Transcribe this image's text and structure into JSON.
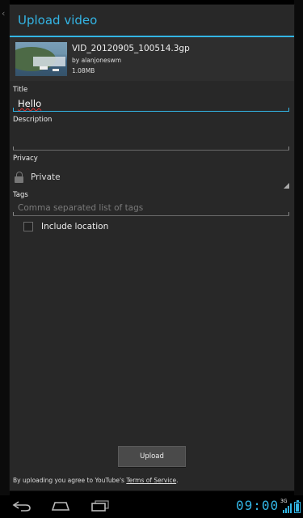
{
  "dialog": {
    "title": "Upload video"
  },
  "file": {
    "name": "VID_20120905_100514.3gp",
    "owner": "by alanjoneswm",
    "size": "1.08MB"
  },
  "form": {
    "title_label": "Title",
    "title_value": "Hello",
    "description_label": "Description",
    "description_value": "",
    "privacy_label": "Privacy",
    "privacy_value": "Private",
    "tags_label": "Tags",
    "tags_placeholder": "Comma separated list of tags",
    "include_location_label": "Include location",
    "include_location_checked": false
  },
  "actions": {
    "upload_label": "Upload"
  },
  "terms": {
    "prefix": "By uploading you agree to YouTube's ",
    "link": "Terms of Service",
    "suffix": "."
  },
  "status_bar": {
    "time": "09:00",
    "network": "3G",
    "accent": "#33b5e5"
  },
  "icons": {
    "lock": "lock-icon",
    "back": "back-icon",
    "home": "home-icon",
    "recent": "recent-apps-icon"
  }
}
